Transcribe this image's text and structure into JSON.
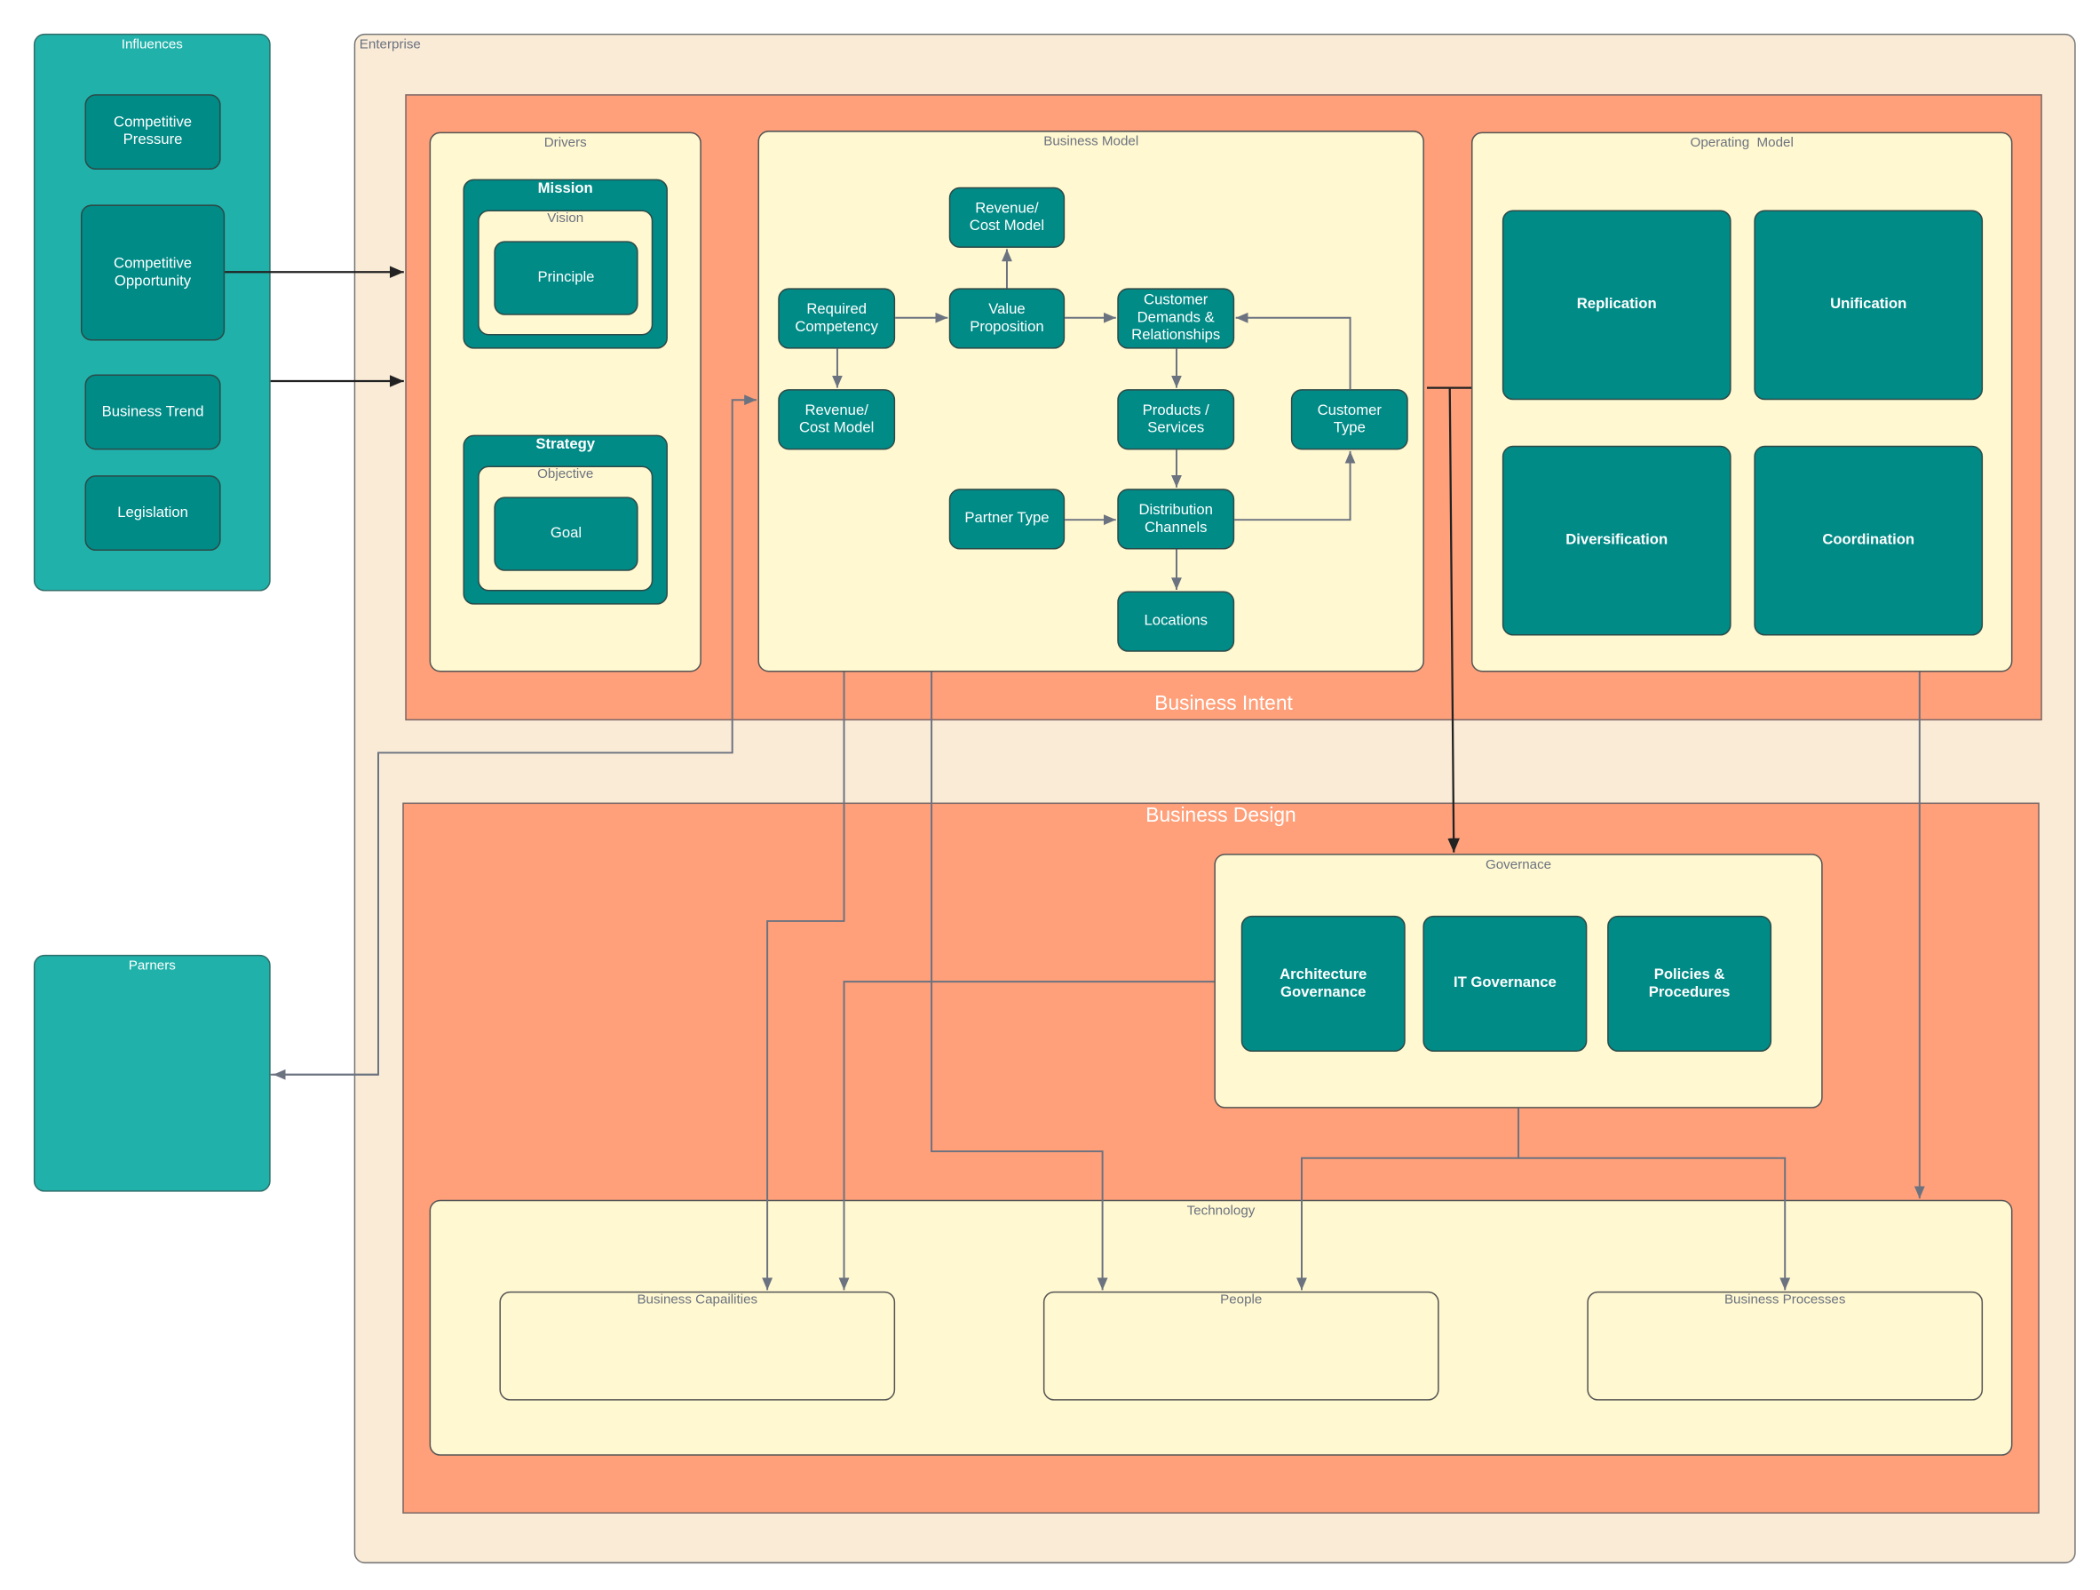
{
  "influences": {
    "title": "Influences",
    "items": [
      "Competitive\nPressure",
      "Competitive\nOpportunity",
      "Business Trend",
      "Legislation"
    ]
  },
  "partners": {
    "title": "Parners"
  },
  "enterprise": {
    "title": "Enterprise"
  },
  "business_intent": {
    "label": "Business Intent",
    "drivers": {
      "title": "Drivers",
      "mission": {
        "title": "Mission",
        "inner_title": "Vision",
        "item": "Principle"
      },
      "strategy": {
        "title": "Strategy",
        "inner_title": "Objective",
        "item": "Goal"
      }
    },
    "business_model": {
      "title": "Business Model",
      "nodes": {
        "revenue_top": "Revenue/\nCost Model",
        "required_competency": "Required\nCompetency",
        "value_proposition": "Value\nProposition",
        "customer_demands": "Customer\nDemands &\nRelationships",
        "revenue_left": "Revenue/\nCost Model",
        "products_services": "Products /\nServices",
        "customer_type": "Customer\nType",
        "partner_type": "Partner Type",
        "distribution_channels": "Distribution\nChannels",
        "locations": "Locations"
      }
    },
    "operating_model": {
      "title": "Operating  Model",
      "items": [
        "Replication",
        "Unification",
        "Diversification",
        "Coordination"
      ]
    }
  },
  "business_design": {
    "label": "Business Design",
    "governance": {
      "title": "Governace",
      "items": [
        "Architecture\nGovernance",
        "IT Governance",
        "Policies &\nProcedures"
      ]
    },
    "technology": {
      "title": "Technology",
      "items": [
        "Business Capailities",
        "People",
        "Business Processes"
      ]
    }
  },
  "colors": {
    "influence_panel": "#20b2aa",
    "node": "#008b87",
    "container": "#fff8d0",
    "section": "#ffa07a",
    "enterprise": "#faebd7",
    "connector": "#6b7280"
  }
}
